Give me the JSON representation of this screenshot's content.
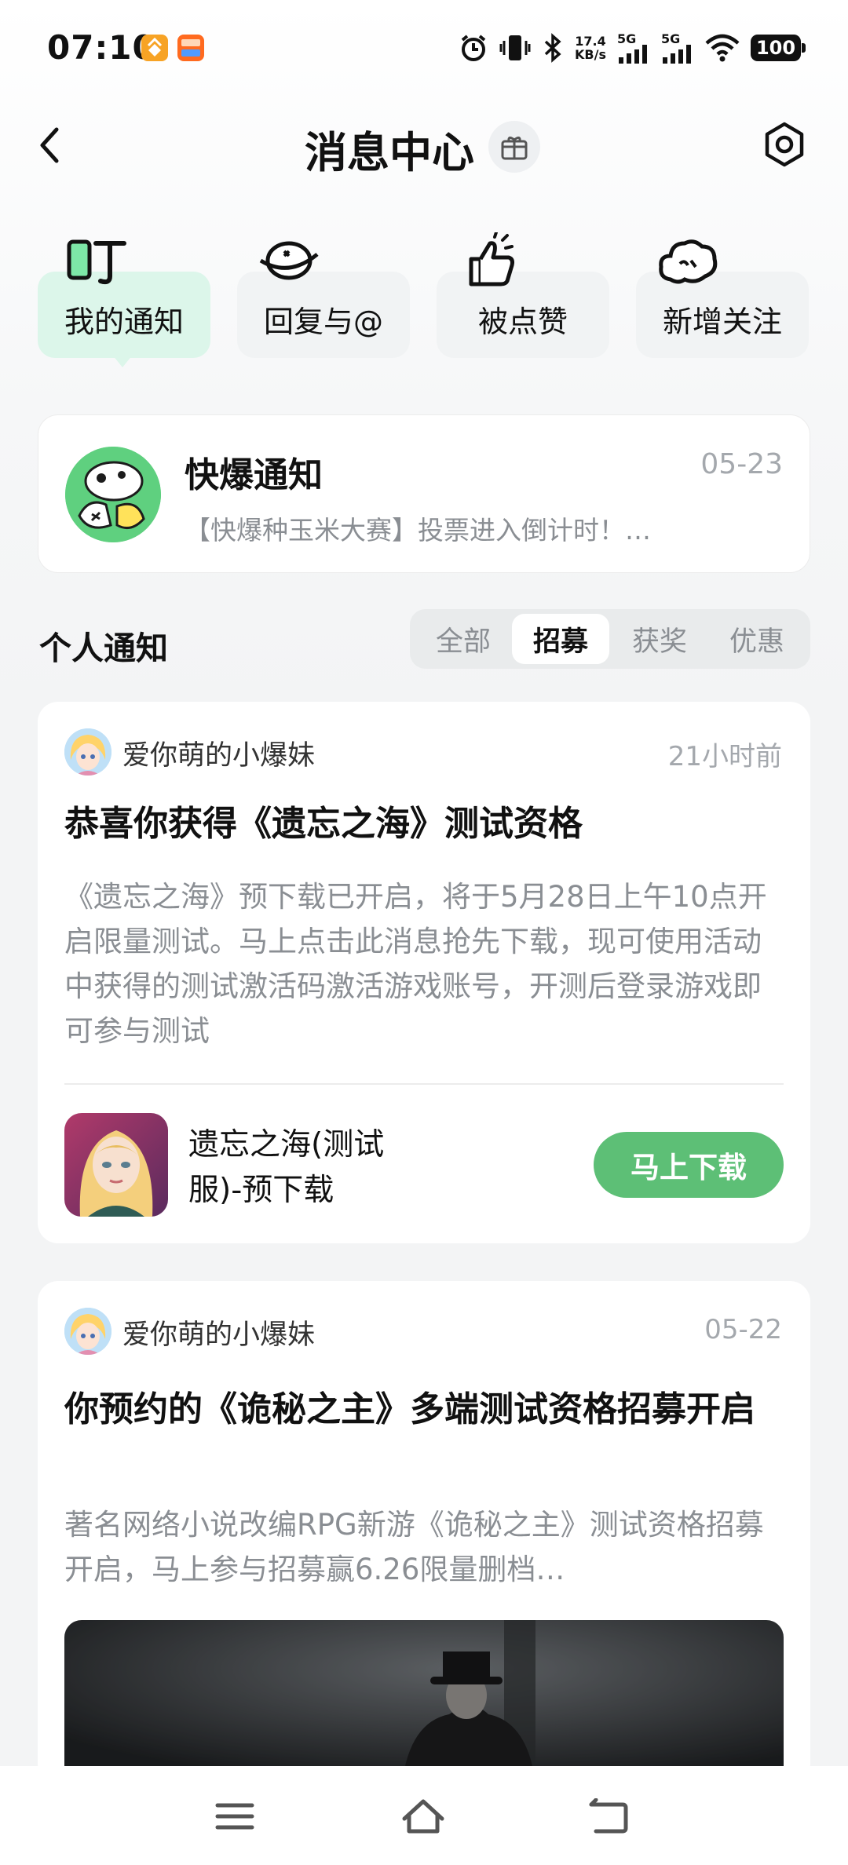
{
  "status_bar": {
    "time": "07:10",
    "net_speed_value": "17.4",
    "net_speed_unit": "KB/s",
    "sim1": "5G",
    "sim2": "5G",
    "battery": "100",
    "app_badges": [
      "orange-app-icon",
      "taobao-flash-icon"
    ],
    "icons": [
      "alarm-icon",
      "vibrate-icon",
      "bluetooth-icon",
      "signal-icon",
      "signal-icon",
      "wifi-icon",
      "battery-icon"
    ]
  },
  "header": {
    "title": "消息中心",
    "back_icon": "chevron-left-icon",
    "title_icon": "gift-box-icon",
    "settings_icon": "gear-icon"
  },
  "categories": [
    {
      "label": "我的通知",
      "icon": "ding-icon",
      "active": true
    },
    {
      "label": "回复与@",
      "icon": "speech-planet-icon",
      "active": false
    },
    {
      "label": "被点赞",
      "icon": "thumbs-up-icon",
      "active": false
    },
    {
      "label": "新增关注",
      "icon": "follow-cloud-icon",
      "active": false
    }
  ],
  "official": {
    "name": "快爆通知",
    "date": "05-23",
    "preview": "【快爆种玉米大赛】投票进入倒计时！…"
  },
  "personal": {
    "title": "个人通知",
    "filters": [
      "全部",
      "招募",
      "获奖",
      "优惠"
    ],
    "active_filter": "招募"
  },
  "messages": [
    {
      "sender": "爱你萌的小爆妹",
      "time": "21小时前",
      "title": "恭喜你获得《遗忘之海》测试资格",
      "body": "《遗忘之海》预下载已开启，将于5月28日上午10点开启限量测试。马上点击此消息抢先下载，现可使用活动中获得的测试激活码激活游戏账号，开测后登录游戏即可参与测试",
      "game_name": "遗忘之海(测试服)-预下载",
      "action": "马上下载"
    },
    {
      "sender": "爱你萌的小爆妹",
      "time": "05-22",
      "title": "你预约的《诡秘之主》多端测试资格招募开启",
      "body": "著名网络小说改编RPG新游《诡秘之主》测试资格招募开启，马上参与招募赢6.26限量删档…"
    }
  ],
  "nav": {
    "icons": [
      "menu-icon",
      "home-icon",
      "back-icon"
    ]
  },
  "colors": {
    "accent_green": "#5dbf76",
    "active_tab_bg": "#dcf6ea",
    "muted_text": "#8a8e93"
  }
}
